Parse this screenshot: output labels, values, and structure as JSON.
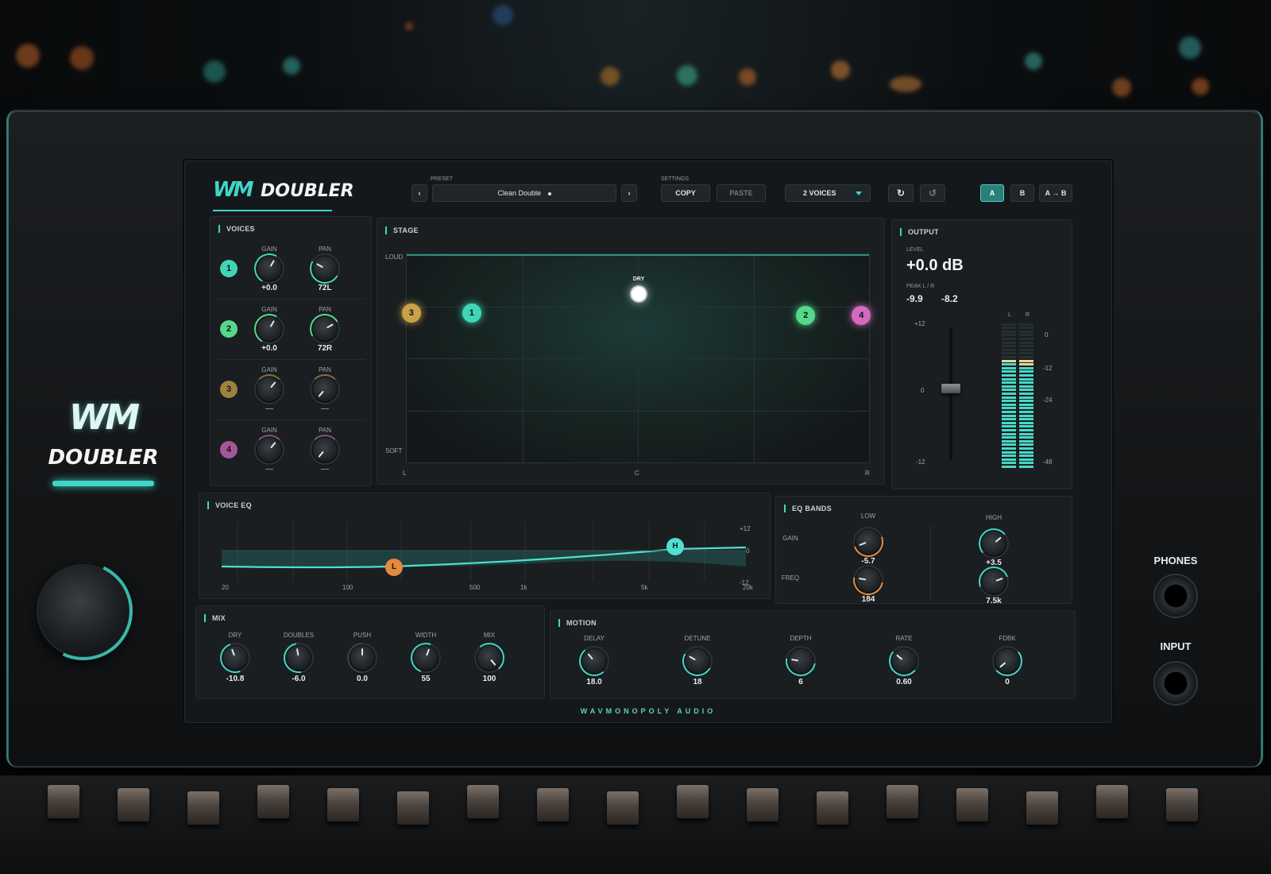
{
  "brand": {
    "logo": "WM",
    "name": "DOUBLER",
    "footer": "WAVMONOPOLY AUDIO"
  },
  "header": {
    "preset_label": "PRESET",
    "preset_name": "Clean Double",
    "preset_prev": "‹",
    "preset_next": "›",
    "settings_label": "SETTINGS",
    "copy": "COPY",
    "paste": "PASTE",
    "voices_select": "2 VOICES",
    "ab": {
      "a": "A",
      "b": "B",
      "atob": "A → B"
    }
  },
  "voices": {
    "title": "VOICES",
    "gain_label": "GAIN",
    "pan_label": "PAN",
    "rows": [
      {
        "num": "1",
        "color": "#3fd6b6",
        "gain": "+0.0",
        "pan": "72L",
        "active": true
      },
      {
        "num": "2",
        "color": "#54d98a",
        "gain": "+0.0",
        "pan": "72R",
        "active": true
      },
      {
        "num": "3",
        "color": "#c9a24a",
        "gain": "—",
        "pan": "—",
        "active": false
      },
      {
        "num": "4",
        "color": "#d26bc0",
        "gain": "—",
        "pan": "—",
        "active": false
      }
    ]
  },
  "stage": {
    "title": "STAGE",
    "loud": "LOUD",
    "soft": "SOFT",
    "left": "L",
    "center": "C",
    "right": "R",
    "dry": "DRY",
    "points": [
      {
        "label": "3",
        "color": "#c9a24a",
        "x": -0.98,
        "y": 0.72
      },
      {
        "label": "1",
        "color": "#3fd6b6",
        "x": -0.72,
        "y": 0.72
      },
      {
        "label": "2",
        "color": "#54d98a",
        "x": 0.72,
        "y": 0.71
      },
      {
        "label": "4",
        "color": "#d26bc0",
        "x": 0.96,
        "y": 0.71
      }
    ],
    "dry_point": {
      "x": 0.0,
      "y": 0.81
    }
  },
  "output": {
    "title": "OUTPUT",
    "level_label": "LEVEL",
    "level": "+0.0 dB",
    "peak_label": "PEAK L / R",
    "peak_l": "-9.9",
    "peak_r": "-8.2",
    "fader_scale": [
      "+12",
      "0",
      "-12"
    ],
    "meter_scale": [
      "0",
      "-12",
      "-24",
      "-48"
    ],
    "meter_l_label": "L",
    "meter_r_label": "R",
    "meter_l_fill": 0.72,
    "meter_r_fill": 0.71
  },
  "voice_eq": {
    "title": "VOICE EQ",
    "freq_ticks": [
      "20",
      "100",
      "500",
      "1k",
      "5k",
      "20k"
    ],
    "db_ticks": [
      "+12",
      "0",
      "-12"
    ],
    "low_handle": "L",
    "high_handle": "H"
  },
  "eq_bands": {
    "title": "EQ BANDS",
    "low_label": "LOW",
    "high_label": "HIGH",
    "gain_label": "GAIN",
    "freq_label": "FREQ",
    "low_gain": "-5.7",
    "low_freq": "184",
    "high_gain": "+3.5",
    "high_freq": "7.5k"
  },
  "mix": {
    "title": "MIX",
    "knobs": [
      {
        "label": "DRY",
        "value": "-10.8"
      },
      {
        "label": "DOUBLES",
        "value": "-6.0"
      },
      {
        "label": "PUSH",
        "value": "0.0"
      },
      {
        "label": "WIDTH",
        "value": "55"
      },
      {
        "label": "MIX",
        "value": "100"
      }
    ]
  },
  "motion": {
    "title": "MOTION",
    "knobs": [
      {
        "label": "DELAY",
        "value": "18.0"
      },
      {
        "label": "DETUNE",
        "value": "18"
      },
      {
        "label": "DEPTH",
        "value": "6"
      },
      {
        "label": "RATE",
        "value": "0.60"
      },
      {
        "label": "FDBK",
        "value": "0"
      }
    ]
  },
  "hardware": {
    "phones": "PHONES",
    "input": "INPUT"
  },
  "colors": {
    "accent": "#3fd6c8",
    "low_band": "#e48a3c"
  }
}
